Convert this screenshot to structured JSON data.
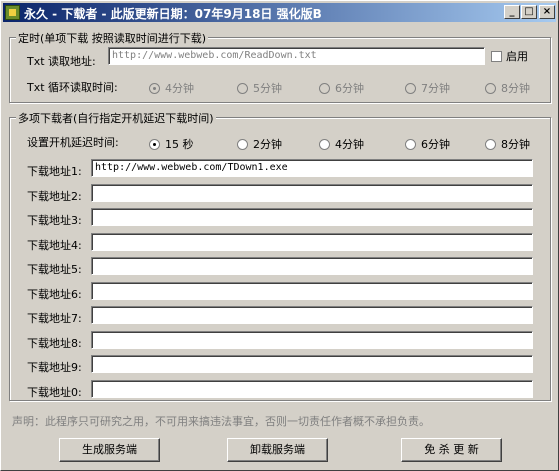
{
  "window": {
    "title": "永久 - 下载者 - 此版更新日期：07年9月18日 强化版B",
    "minimize_glyph": "_",
    "maximize_glyph": "□",
    "close_glyph": "×"
  },
  "single": {
    "group_title": "定时(单项下载  按照读取时间进行下载)",
    "txt_read_label": "Txt 读取地址:",
    "txt_url": "http://www.webweb.com/ReadDown.txt",
    "enable_label": "启用",
    "loop_label": "Txt 循环读取时间:",
    "loop_options": [
      "4分钟",
      "5分钟",
      "6分钟",
      "7分钟",
      "8分钟"
    ],
    "loop_selected": "4分钟"
  },
  "multi": {
    "group_title": "多项下载者(自行指定开机延迟下载时间)",
    "delay_label": "设置开机延迟时间:",
    "delay_options": [
      "15 秒",
      "2分钟",
      "4分钟",
      "6分钟",
      "8分钟"
    ],
    "delay_selected": "15 秒",
    "download_rows": [
      {
        "label": "下载地址1:",
        "value": "http://www.webweb.com/TDown1.exe"
      },
      {
        "label": "下载地址2:",
        "value": ""
      },
      {
        "label": "下载地址3:",
        "value": ""
      },
      {
        "label": "下载地址4:",
        "value": ""
      },
      {
        "label": "下载地址5:",
        "value": ""
      },
      {
        "label": "下载地址6:",
        "value": ""
      },
      {
        "label": "下载地址7:",
        "value": ""
      },
      {
        "label": "下载地址8:",
        "value": ""
      },
      {
        "label": "下载地址9:",
        "value": ""
      },
      {
        "label": "下载地址0:",
        "value": ""
      }
    ]
  },
  "notice": "声明：此程序只可研究之用，不可用来搞违法事宜，否则一切责任作者概不承担负责。",
  "buttons": {
    "generate": "生成服务端",
    "uninstall": "卸载服务端",
    "free_update": "免 杀 更 新"
  }
}
